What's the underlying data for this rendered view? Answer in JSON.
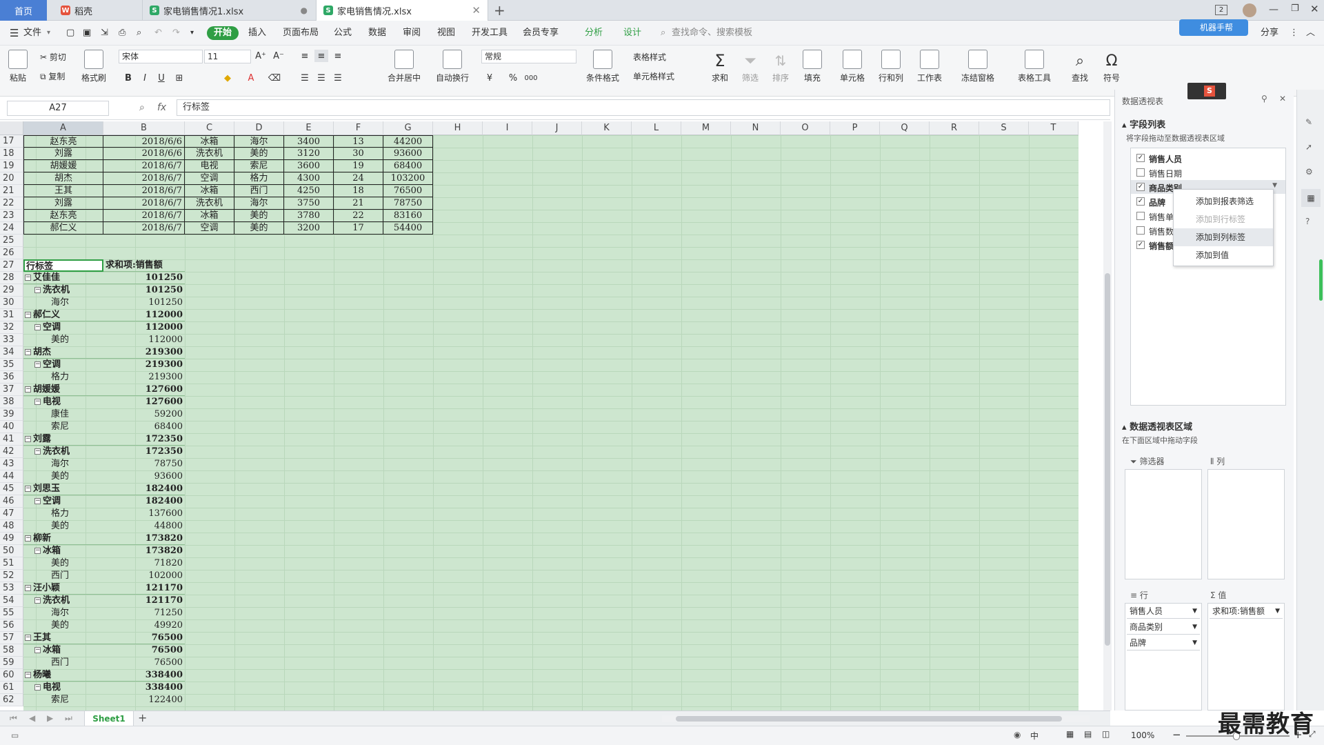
{
  "tabs": [
    {
      "label": "首页"
    },
    {
      "label": "稻壳"
    },
    {
      "label": "家电销售情况1.xlsx"
    },
    {
      "label": "家电销售情况.xlsx"
    }
  ],
  "window_badge": "2",
  "menu": {
    "file": "文件",
    "items": [
      "开始",
      "插入",
      "页面布局",
      "公式",
      "数据",
      "审阅",
      "视图",
      "开发工具",
      "会员专享",
      "分析",
      "设计"
    ],
    "search_placeholder": "查找命令、搜索模板",
    "share": "分享",
    "collab_badge": "机器手帮"
  },
  "ribbon": {
    "paste": "粘贴",
    "cut": "剪切",
    "copy": "复制",
    "format_painter": "格式刷",
    "font_name": "宋体",
    "font_size": "11",
    "merge_center": "合并居中",
    "wrap": "自动换行",
    "number_format": "常规",
    "cond_format": "条件格式",
    "table_style": "表格样式",
    "cell_style": "单元格样式",
    "sum": "求和",
    "filter": "筛选",
    "sort": "排序",
    "fill": "填充",
    "cell": "单元格",
    "rowcol": "行和列",
    "worksheet": "工作表",
    "freeze": "冻结窗格",
    "table_tools": "表格工具",
    "find": "查找",
    "symbol": "符号",
    "yuan": "¥",
    "percent": "%",
    "thousands": "000"
  },
  "formula": {
    "name_box": "A27",
    "fx": "fx",
    "value": "行标签"
  },
  "columns": [
    "A",
    "B",
    "C",
    "D",
    "E",
    "F",
    "G",
    "H",
    "I",
    "J",
    "K",
    "L",
    "M",
    "N",
    "O",
    "P",
    "Q",
    "R",
    "S",
    "T"
  ],
  "data_rows": [
    {
      "row": "17",
      "a": "赵东亮",
      "b": "2018/6/6",
      "c": "冰箱",
      "d": "海尔",
      "e": "3400",
      "f": "13",
      "g": "44200"
    },
    {
      "row": "18",
      "a": "刘露",
      "b": "2018/6/6",
      "c": "洗衣机",
      "d": "美的",
      "e": "3120",
      "f": "30",
      "g": "93600"
    },
    {
      "row": "19",
      "a": "胡媛媛",
      "b": "2018/6/7",
      "c": "电视",
      "d": "索尼",
      "e": "3600",
      "f": "19",
      "g": "68400"
    },
    {
      "row": "20",
      "a": "胡杰",
      "b": "2018/6/7",
      "c": "空调",
      "d": "格力",
      "e": "4300",
      "f": "24",
      "g": "103200"
    },
    {
      "row": "21",
      "a": "王其",
      "b": "2018/6/7",
      "c": "冰箱",
      "d": "西门",
      "e": "4250",
      "f": "18",
      "g": "76500"
    },
    {
      "row": "22",
      "a": "刘露",
      "b": "2018/6/7",
      "c": "洗衣机",
      "d": "海尔",
      "e": "3750",
      "f": "21",
      "g": "78750"
    },
    {
      "row": "23",
      "a": "赵东亮",
      "b": "2018/6/7",
      "c": "冰箱",
      "d": "美的",
      "e": "3780",
      "f": "22",
      "g": "83160"
    },
    {
      "row": "24",
      "a": "郝仁义",
      "b": "2018/6/7",
      "c": "空调",
      "d": "美的",
      "e": "3200",
      "f": "17",
      "g": "54400"
    }
  ],
  "empty_rows": [
    "25",
    "26"
  ],
  "pivot_header": {
    "row": "27",
    "a": "行标签",
    "b": "求和项:销售额"
  },
  "pivot_rows": [
    {
      "row": "28",
      "level": 0,
      "label": "艾佳佳",
      "value": "101250"
    },
    {
      "row": "29",
      "level": 1,
      "label": "洗衣机",
      "value": "101250"
    },
    {
      "row": "30",
      "level": 2,
      "label": "海尔",
      "value": "101250"
    },
    {
      "row": "31",
      "level": 0,
      "label": "郝仁义",
      "value": "112000"
    },
    {
      "row": "32",
      "level": 1,
      "label": "空调",
      "value": "112000"
    },
    {
      "row": "33",
      "level": 2,
      "label": "美的",
      "value": "112000"
    },
    {
      "row": "34",
      "level": 0,
      "label": "胡杰",
      "value": "219300"
    },
    {
      "row": "35",
      "level": 1,
      "label": "空调",
      "value": "219300"
    },
    {
      "row": "36",
      "level": 2,
      "label": "格力",
      "value": "219300"
    },
    {
      "row": "37",
      "level": 0,
      "label": "胡媛媛",
      "value": "127600"
    },
    {
      "row": "38",
      "level": 1,
      "label": "电视",
      "value": "127600"
    },
    {
      "row": "39",
      "level": 2,
      "label": "康佳",
      "value": "59200"
    },
    {
      "row": "40",
      "level": 2,
      "label": "索尼",
      "value": "68400"
    },
    {
      "row": "41",
      "level": 0,
      "label": "刘露",
      "value": "172350"
    },
    {
      "row": "42",
      "level": 1,
      "label": "洗衣机",
      "value": "172350"
    },
    {
      "row": "43",
      "level": 2,
      "label": "海尔",
      "value": "78750"
    },
    {
      "row": "44",
      "level": 2,
      "label": "美的",
      "value": "93600"
    },
    {
      "row": "45",
      "level": 0,
      "label": "刘思玉",
      "value": "182400"
    },
    {
      "row": "46",
      "level": 1,
      "label": "空调",
      "value": "182400"
    },
    {
      "row": "47",
      "level": 2,
      "label": "格力",
      "value": "137600"
    },
    {
      "row": "48",
      "level": 2,
      "label": "美的",
      "value": "44800"
    },
    {
      "row": "49",
      "level": 0,
      "label": "柳新",
      "value": "173820"
    },
    {
      "row": "50",
      "level": 1,
      "label": "冰箱",
      "value": "173820"
    },
    {
      "row": "51",
      "level": 2,
      "label": "美的",
      "value": "71820"
    },
    {
      "row": "52",
      "level": 2,
      "label": "西门",
      "value": "102000"
    },
    {
      "row": "53",
      "level": 0,
      "label": "汪小颖",
      "value": "121170"
    },
    {
      "row": "54",
      "level": 1,
      "label": "洗衣机",
      "value": "121170"
    },
    {
      "row": "55",
      "level": 2,
      "label": "海尔",
      "value": "71250"
    },
    {
      "row": "56",
      "level": 2,
      "label": "美的",
      "value": "49920"
    },
    {
      "row": "57",
      "level": 0,
      "label": "王其",
      "value": "76500"
    },
    {
      "row": "58",
      "level": 1,
      "label": "冰箱",
      "value": "76500"
    },
    {
      "row": "59",
      "level": 2,
      "label": "西门",
      "value": "76500"
    },
    {
      "row": "60",
      "level": 0,
      "label": "杨曦",
      "value": "338400"
    },
    {
      "row": "61",
      "level": 1,
      "label": "电视",
      "value": "338400"
    },
    {
      "row": "62",
      "level": 2,
      "label": "索尼",
      "value": "122400"
    }
  ],
  "pane": {
    "title": "数据透视表",
    "field_list_title": "字段列表",
    "field_list_hint": "将字段拖动至数据透视表区域",
    "fields": [
      {
        "label": "销售人员",
        "checked": true,
        "bold": true
      },
      {
        "label": "销售日期",
        "checked": false,
        "bold": false
      },
      {
        "label": "商品类别",
        "checked": true,
        "bold": true
      },
      {
        "label": "品牌",
        "checked": true,
        "bold": true
      },
      {
        "label": "销售单价",
        "checked": false,
        "bold": false
      },
      {
        "label": "销售数量",
        "checked": false,
        "bold": false
      },
      {
        "label": "销售额",
        "checked": true,
        "bold": true
      }
    ],
    "context_menu": [
      {
        "label": "添加到报表筛选",
        "disabled": false
      },
      {
        "label": "添加到行标签",
        "disabled": true
      },
      {
        "label": "添加到列标签",
        "disabled": false,
        "highlighted": true
      },
      {
        "label": "添加到值",
        "disabled": false
      }
    ],
    "area_title": "数据透视表区域",
    "area_hint": "在下面区域中拖动字段",
    "filter_label": "筛选器",
    "column_label": "列",
    "row_label": "行",
    "value_label": "值",
    "row_fields": [
      "销售人员",
      "商品类别",
      "品牌"
    ],
    "value_fields": [
      "求和项:销售额"
    ]
  },
  "sheet_tab": "Sheet1",
  "status": {
    "zoom": "100%",
    "input_mode": "中"
  },
  "watermark": "最需教育",
  "colors": {
    "grid_fill": "#cde6cf",
    "accent_green": "#2f9e44",
    "tab_active_bg": "#ffffff"
  }
}
